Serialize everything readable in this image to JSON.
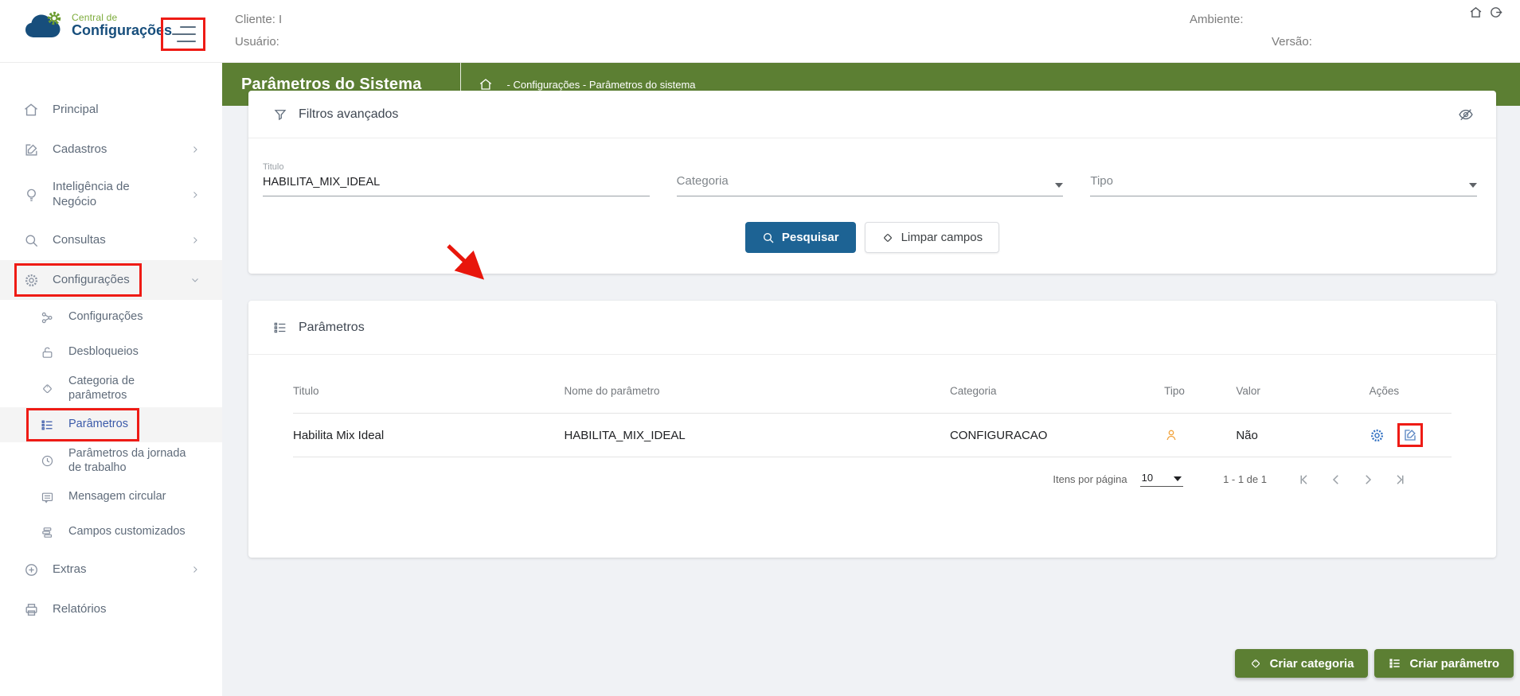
{
  "colors": {
    "header_green": "#5c7f33",
    "primary_blue": "#1d6394",
    "active_blue": "#3b5aa9",
    "annotation_red": "#ee1b15",
    "tipo_icon_orange": "#f2a33c",
    "action_icon_blue": "#2f6fc1"
  },
  "topbar": {
    "logo_line1": "Central de",
    "logo_line2": "Configurações",
    "cliente": "Cliente: I",
    "usuario": "Usuário:",
    "ambiente": "Ambiente:",
    "versao": "Versão:"
  },
  "page_header": {
    "title": "Parâmetros do Sistema",
    "breadcrumb": "- Configurações - Parâmetros do sistema"
  },
  "sidebar": {
    "items": [
      {
        "label": "Principal"
      },
      {
        "label": "Cadastros"
      },
      {
        "label": "Inteligência de Negócio"
      },
      {
        "label": "Consultas"
      },
      {
        "label": "Configurações"
      },
      {
        "label": "Configurações"
      },
      {
        "label": "Desbloqueios"
      },
      {
        "label": "Categoria de parâmetros"
      },
      {
        "label": "Parâmetros"
      },
      {
        "label": "Parâmetros da jornada de trabalho"
      },
      {
        "label": "Mensagem circular"
      },
      {
        "label": "Campos customizados"
      },
      {
        "label": "Extras"
      },
      {
        "label": "Relatórios"
      }
    ]
  },
  "filters": {
    "title": "Filtros avançados",
    "titulo_label": "Titulo",
    "titulo_value": "HABILITA_MIX_IDEAL",
    "categoria_placeholder": "Categoria",
    "tipo_placeholder": "Tipo",
    "search_button": "Pesquisar",
    "clear_button": "Limpar campos"
  },
  "parameters": {
    "title": "Parâmetros",
    "columns": [
      "Titulo",
      "Nome do parâmetro",
      "Categoria",
      "Tipo",
      "Valor",
      "Ações"
    ],
    "rows": [
      {
        "titulo": "Habilita Mix Ideal",
        "nome": "HABILITA_MIX_IDEAL",
        "categoria": "CONFIGURACAO",
        "tipo_icon": "person-icon",
        "valor": "Não"
      }
    ]
  },
  "pagination": {
    "items_per_page_label": "Itens por página",
    "page_size": "10",
    "range_label": "1 - 1 de 1"
  },
  "fab": {
    "create_category": "Criar categoria",
    "create_parameter": "Criar parâmetro"
  }
}
